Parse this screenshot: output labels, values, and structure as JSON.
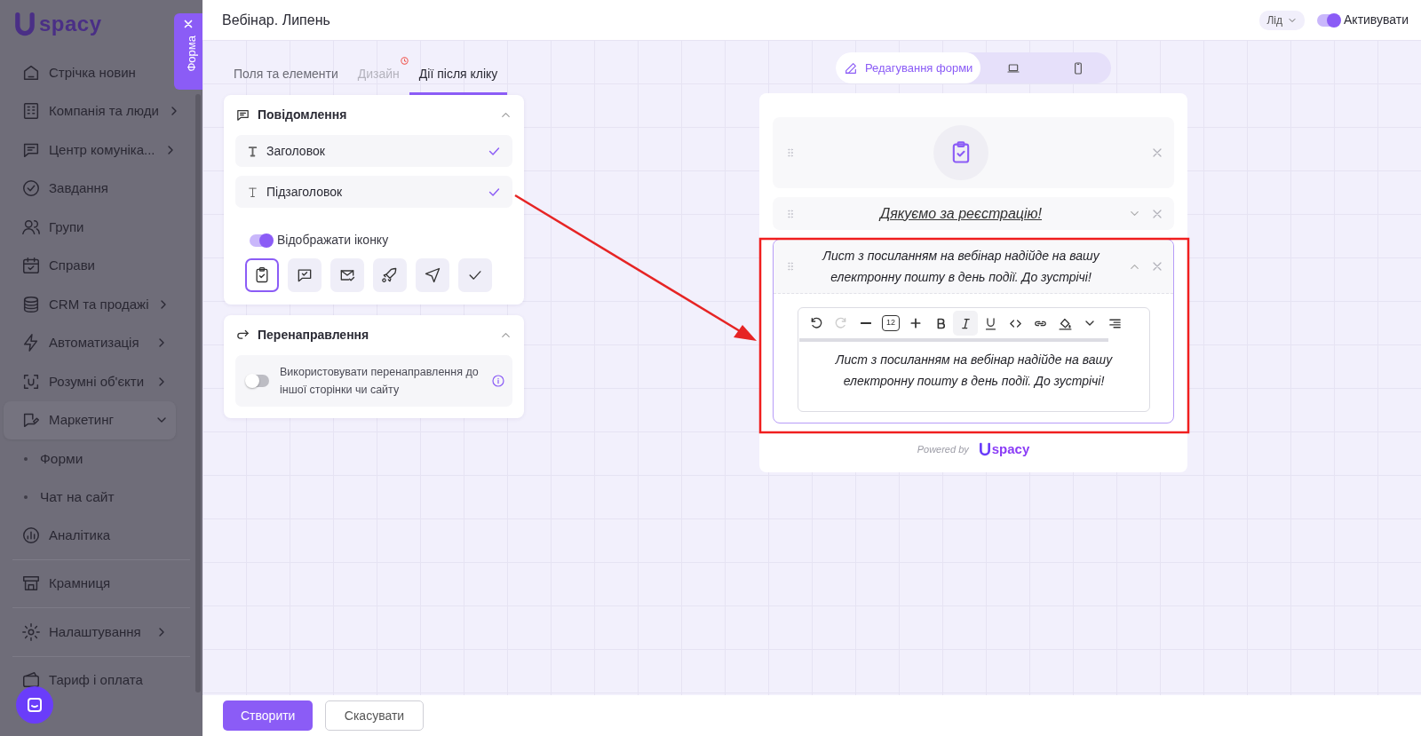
{
  "sidebar": {
    "logo": "spacy",
    "items": [
      {
        "label": "Стрічка новин"
      },
      {
        "label": "Компанія та люди",
        "expanded": false
      },
      {
        "label": "Центр комуніка...",
        "expanded": false
      },
      {
        "label": "Завдання"
      },
      {
        "label": "Групи"
      },
      {
        "label": "Справи"
      },
      {
        "label": "CRM та продажі",
        "expanded": false
      },
      {
        "label": "Автоматизація",
        "expanded": false
      },
      {
        "label": "Розумні об'єкти",
        "expanded": false
      },
      {
        "label": "Маркетинг",
        "expanded": true,
        "children": [
          {
            "label": "Форми"
          },
          {
            "label": "Чат на сайт"
          }
        ]
      },
      {
        "label": "Аналітика"
      },
      {
        "label": "Крамниця"
      },
      {
        "label": "Налаштування",
        "expanded": false
      },
      {
        "label": "Тариф і оплата"
      }
    ]
  },
  "panel_tab": {
    "label": "Форма"
  },
  "header": {
    "title": "Вебінар. Липень",
    "entity": "Лід",
    "activate": {
      "label": "Активувати",
      "on": true
    }
  },
  "tabs": [
    {
      "label": "Поля та елементи",
      "selected": false,
      "disabled": false
    },
    {
      "label": "Дизайн",
      "selected": false,
      "disabled": true
    },
    {
      "label": "Дії після кліку",
      "selected": true,
      "disabled": false
    }
  ],
  "message": {
    "title": "Повідомлення",
    "expanded": true,
    "fields": [
      {
        "label": "Заголовок",
        "kind": "heading",
        "checked": true
      },
      {
        "label": "Підзаголовок",
        "kind": "subheading",
        "checked": true
      }
    ],
    "show_icon": {
      "label": "Відображати іконку",
      "on": true
    },
    "icon_choices": [
      {
        "selected": true
      },
      {
        "selected": false
      },
      {
        "selected": false
      },
      {
        "selected": false
      },
      {
        "selected": false
      },
      {
        "selected": false
      }
    ]
  },
  "redirect": {
    "title": "Перенаправлення",
    "expanded": true,
    "option": {
      "label": "Використовувати перенаправлення до іншої сторінки чи сайту",
      "on": false
    }
  },
  "view_switcher": [
    {
      "label": "Редагування форми",
      "selected": true
    },
    {
      "selected": false
    },
    {
      "selected": false
    }
  ],
  "preview": {
    "blocks": [
      {
        "kind": "icon",
        "expanded": false
      },
      {
        "kind": "title",
        "text": "Дякуємо за реєстрацію!",
        "expanded": false
      },
      {
        "kind": "text",
        "text": "Лист з посиланням на вебінар надійде на вашу електронну пошту в день події. До зустрічі!",
        "expanded": true,
        "editor": {
          "font_size": "12",
          "text": "Лист з посиланням на вебінар надійде на вашу електронну пошту в день події. До зустрічі!",
          "tools": [
            {
              "kind": "undo",
              "selected": false,
              "disabled": false
            },
            {
              "kind": "redo",
              "selected": false,
              "disabled": true
            },
            {
              "kind": "minus",
              "selected": false,
              "disabled": false
            },
            {
              "kind": "size",
              "selected": false,
              "disabled": false
            },
            {
              "kind": "plus",
              "selected": false,
              "disabled": false
            },
            {
              "kind": "bold",
              "selected": false,
              "disabled": false
            },
            {
              "kind": "italic",
              "selected": true,
              "disabled": false
            },
            {
              "kind": "underline",
              "selected": false,
              "disabled": false
            },
            {
              "kind": "code",
              "selected": false,
              "disabled": false
            },
            {
              "kind": "link",
              "selected": false,
              "disabled": false
            },
            {
              "kind": "fill",
              "selected": false,
              "disabled": false
            },
            {
              "kind": "caret",
              "selected": false,
              "disabled": false
            },
            {
              "kind": "align",
              "selected": false,
              "disabled": false
            }
          ]
        }
      }
    ],
    "powered_by": "Powered by",
    "logo": "spacy"
  },
  "footer": {
    "buttons": [
      {
        "label": "Створити",
        "kind": "primary"
      },
      {
        "label": "Скасувати",
        "kind": "secondary"
      }
    ]
  }
}
